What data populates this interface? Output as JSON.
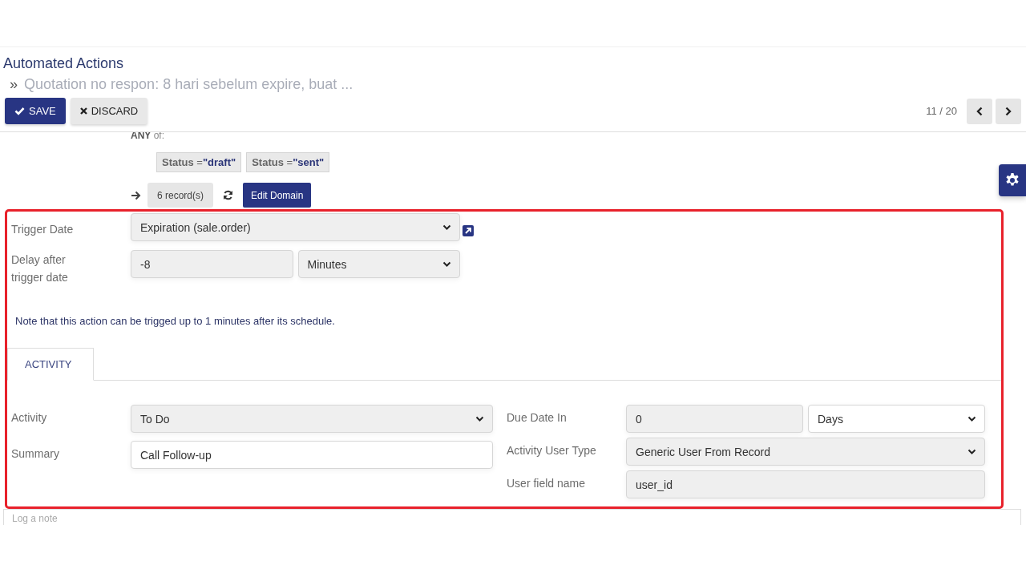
{
  "title": "Automated Actions",
  "breadcrumb": {
    "separator": "»",
    "text": "Quotation no respon: 8 hari sebelum expire, buat ..."
  },
  "buttons": [
    {
      "label": "SAVE",
      "kind": "primary"
    },
    {
      "label": "DISCARD",
      "kind": "secondary"
    }
  ],
  "pager": "11 / 20",
  "domain": {
    "match": "**ANY** of:",
    "conditions": [
      {
        "field": "Status",
        "operator": "=",
        "value": "\"draft\""
      },
      {
        "field": "Status",
        "operator": "=",
        "value": "\"sent\""
      }
    ],
    "record_count": "6 record(s)",
    "edit_button": "Edit Domain"
  },
  "schedule_fields": [
    {
      "label": "Trigger Date",
      "controls": [
        {
          "kind": "select",
          "value": "Expiration (sale.order)",
          "required": true
        }
      ]
    },
    {
      "label": "Delay after trigger date",
      "controls": [
        {
          "kind": "input",
          "value": "-8",
          "required": true
        },
        {
          "kind": "select",
          "value": "Minutes",
          "required": true
        }
      ]
    }
  ],
  "note": "Note that this action can be trigged up to 1 minutes after its schedule.",
  "tabs": [
    {
      "label": "ACTIVITY",
      "selected": true
    }
  ],
  "left_fields": [
    {
      "label": "Activity",
      "controls": [
        {
          "kind": "select",
          "value": "To Do",
          "required": true
        }
      ]
    },
    {
      "label": "Summary",
      "controls": [
        {
          "kind": "input",
          "value": "Call Follow-up",
          "required": false
        }
      ]
    }
  ],
  "right_fields": [
    {
      "label": "Due Date In",
      "controls": [
        {
          "kind": "input",
          "value": "0",
          "required": true
        },
        {
          "kind": "select",
          "value": "Days",
          "required": false
        }
      ]
    },
    {
      "label": "Activity User Type",
      "controls": [
        {
          "kind": "select",
          "value": "Generic User From Record",
          "required": true
        }
      ]
    },
    {
      "label": "User field name",
      "controls": [
        {
          "kind": "input",
          "value": "user_id",
          "required": true
        }
      ]
    }
  ],
  "log_note": "Log a note"
}
